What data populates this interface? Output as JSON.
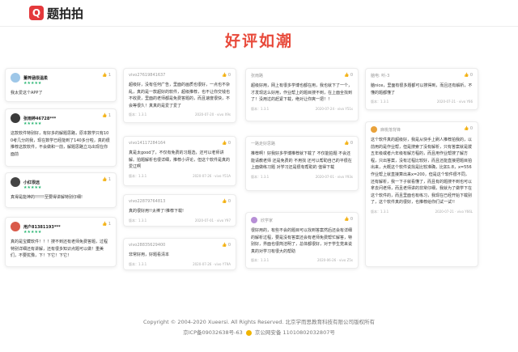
{
  "app": {
    "logo_mark": "Q",
    "name": "题拍拍"
  },
  "title": "好评如潮",
  "cards": [
    {
      "user": "董梓涵很温柔",
      "stars": "★★★★★",
      "like": "1",
      "text": "我太爱这个APP了",
      "meta_left": "",
      "meta_right": ""
    },
    {
      "user": "张雨婷46728***",
      "stars": "★★★★★",
      "like": "1",
      "text": "这款软件特别好，有好多的解题思路，原本数学只有100考几分的我，现在数学已经能到了140多分啦，真的很推荐这款软件，不会做和一前，解题思路立马出现在你面前",
      "meta_left": "",
      "meta_right": ""
    },
    {
      "user": "小红很远",
      "stars": "★★★★★",
      "like": "1",
      "text": "真得是能神的!!!!!!至要得讲解特别仔细!",
      "meta_left": "",
      "meta_right": ""
    },
    {
      "user": "用户81381193***",
      "stars": "★★★★★",
      "like": "1",
      "text": "真的是宝藏软件！！！搜不到还有老师免费答题，过程特别详细还有讲解，还有很多知识点题可以做！重美们，不要犹豫，下！下它！下它！",
      "meta_left": "",
      "meta_right": ""
    },
    {
      "user": "vivo27619841637",
      "stars": "",
      "like": "0",
      "text": "超级好，没有任何广告，里面的画质也很好，一点也不杂乱，真的是一款超好的软件，超级推荐，也不让你交钱也不收费，里面的老师都是免费答题的，而且速度很快，不会等很久！真真的是爱了爱了",
      "meta_left": "版本：1.3.1",
      "meta_right": "2020-07-20 · vivo X9s"
    },
    {
      "user": "vivo14117284164",
      "stars": "",
      "like": "0",
      "text": "真是太good了，不仅有免费的习题选，还可以老师讲解。拍题解析也很详细，推荐小评论，但这个软件是真的爱辽啊",
      "meta_left": "版本：1.3.1",
      "meta_right": "2020-07-26 · vivo Y51A"
    },
    {
      "user": "vivo22879764813",
      "stars": "",
      "like": "0",
      "text": "真的很好用!!太棒了!推荐下载!",
      "meta_left": "版本：1.3.1",
      "meta_right": "2020-07-01 · vivo Y97"
    },
    {
      "user": "vivo28835629400",
      "stars": "",
      "like": "0",
      "text": "非常好用，好题看清本",
      "meta_left": "版本：1.3.1",
      "meta_right": "2020-07-26 · vivo Y79A"
    },
    {
      "user": "张雨路",
      "stars": "",
      "like": "0",
      "text": "超级好用，网上有很多学博也都在用，我也就下了一个，才发现这么好用，作业帮上的题目搜不到，在上面全找到了！没用过的赶紧下载，绝对让你爽一把！！",
      "meta_left": "版本：1.3.1",
      "meta_right": "2020-07-24 · vivo Y51s"
    },
    {
      "user": "一路走好思路",
      "stars": "",
      "like": "0",
      "text": "推荐啊！好我好多学博推荐就下载了 不仅能拍题 不会还能请教老师 还是免费的 不用找 还可以帮助自己的平很在上面做练习题 对学习还是很有帮助的 值得下载",
      "meta_left": "版本：1.3.1",
      "meta_right": "2020-07-01 · vivo Y93s"
    },
    {
      "user": "欣学家",
      "stars": "",
      "like": "0",
      "text": "很好用的，有些不会的题目可以找到答案然后还会有详细的解析过程，要是没有答案还会有老师免费帮忙解答，特别好，界面也很简洁明了，总体都很好，对于学生党来说真的对学习有很大的帮助",
      "meta_left": "版本：1.3.1",
      "meta_right": "2020-06-26 · vivo Z5s"
    },
    {
      "user": "脑电: 听-3",
      "stars": "",
      "like": "0",
      "text": "脑nice，里面有很多题都可以搜得到，而且还有解析，不懂的题都懂了",
      "meta_left": "版本：1.3.1",
      "meta_right": "2020-07-21 · vivo Y66"
    },
    {
      "user": "麻桃落背锋",
      "stars": "★★★★★",
      "like": "0",
      "text": "这个软件真的超级好，我是从快手上刷人推荐拍我的，以前用的是作业帮，但是搜索了没有解析，只有答案就是拨五年级或者六年级有解方程的，而且用作业帮搜了解方程，只出答案，没有过程比较好，而且还能直接把题目拍出来，大概这个软件说找是比较准确，比如1.8，x=556作业帮上就直接算出来x=200，但是这个软件很不同，还有解析，我一下子就看懂了，而且有的题搜不到也可以拿去问老师，而且老师讲的非常仔细，我就为了做学下在这个软件的，而且里面也有练习，我现在已经开始下载别了，这个软件真的很好，也推荐给你们试一试!!",
      "meta_left": "版本：1.3.1",
      "meta_right": "2020-07-21 · vivo Y66L"
    }
  ],
  "footer": {
    "copyright": "Copyright © 2004-2020 Xueersi. All Rights Reserved. 北京学而思教育科技有限公司版权所有",
    "icp": "京ICP备09032638号-63",
    "police": "京公网安备 11010802032807号"
  }
}
